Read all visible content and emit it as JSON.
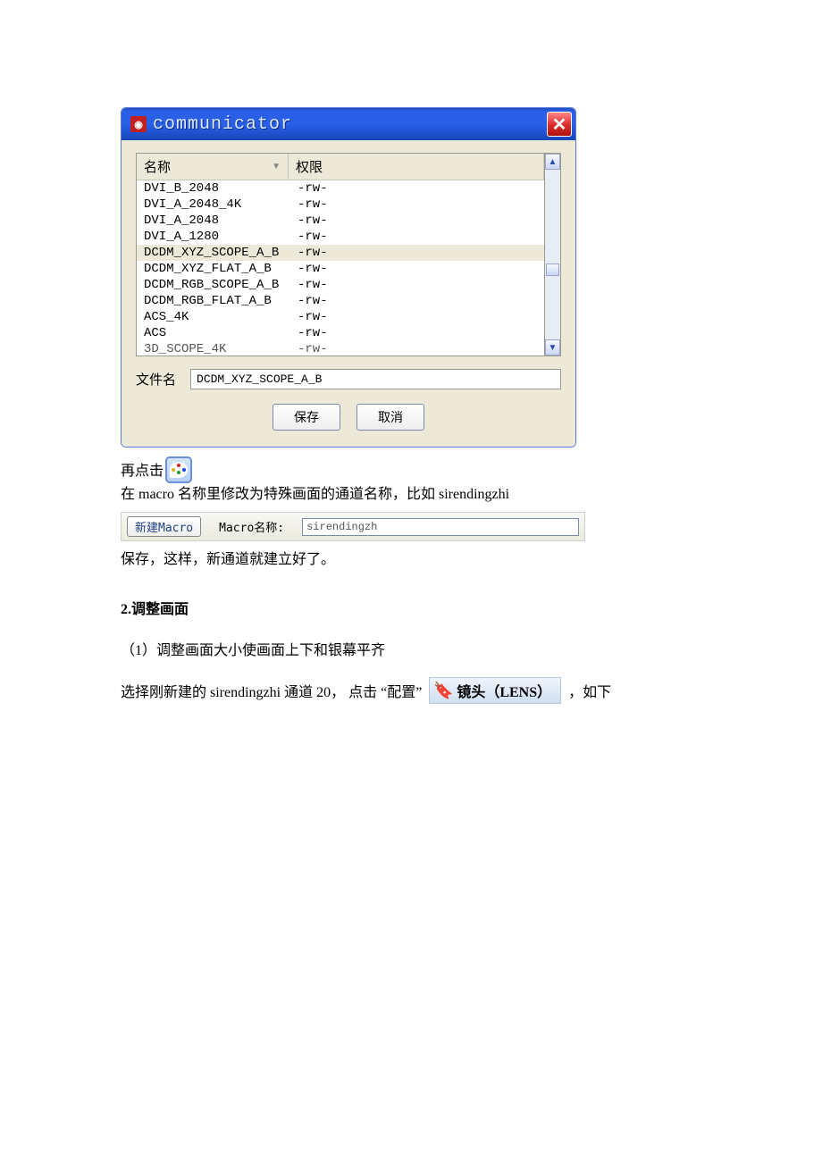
{
  "dialog": {
    "title": "communicator",
    "columns": {
      "name": "名称",
      "perm": "权限"
    },
    "rows": [
      {
        "name": "DVI_B_2048",
        "perm": "-rw-",
        "selected": false
      },
      {
        "name": "DVI_A_2048_4K",
        "perm": "-rw-",
        "selected": false
      },
      {
        "name": "DVI_A_2048",
        "perm": "-rw-",
        "selected": false
      },
      {
        "name": "DVI_A_1280",
        "perm": "-rw-",
        "selected": false
      },
      {
        "name": "DCDM_XYZ_SCOPE_A_B",
        "perm": "-rw-",
        "selected": true
      },
      {
        "name": "DCDM_XYZ_FLAT_A_B",
        "perm": "-rw-",
        "selected": false
      },
      {
        "name": "DCDM_RGB_SCOPE_A_B",
        "perm": "-rw-",
        "selected": false
      },
      {
        "name": "DCDM_RGB_FLAT_A_B",
        "perm": "-rw-",
        "selected": false
      },
      {
        "name": "ACS_4K",
        "perm": "-rw-",
        "selected": false
      },
      {
        "name": "ACS",
        "perm": "-rw-",
        "selected": false
      },
      {
        "name": "3D_SCOPE_4K",
        "perm": "-rw-",
        "selected": false
      }
    ],
    "filename_label": "文件名",
    "filename_value": "DCDM_XYZ_SCOPE_A_B",
    "save_label": "保存",
    "cancel_label": "取消"
  },
  "body_text": {
    "again_click": "再点击",
    "macro_instruction": "在 macro 名称里修改为特殊画面的通道名称，比如 sirendingzhi",
    "save_done": "保存，这样，新通道就建立好了。",
    "section2": "2.调整画面",
    "step1": "（1）调整画面大小使画面上下和银幕平齐",
    "config_pre": "选择刚新建的 sirendingzhi 通道 20， 点击 “配置”",
    "config_post": "，如下"
  },
  "macro_bar": {
    "new_btn": "新建Macro",
    "name_label": "Macro名称:",
    "name_value": "sirendingzh"
  },
  "lens": {
    "label": "镜头（LENS）"
  }
}
